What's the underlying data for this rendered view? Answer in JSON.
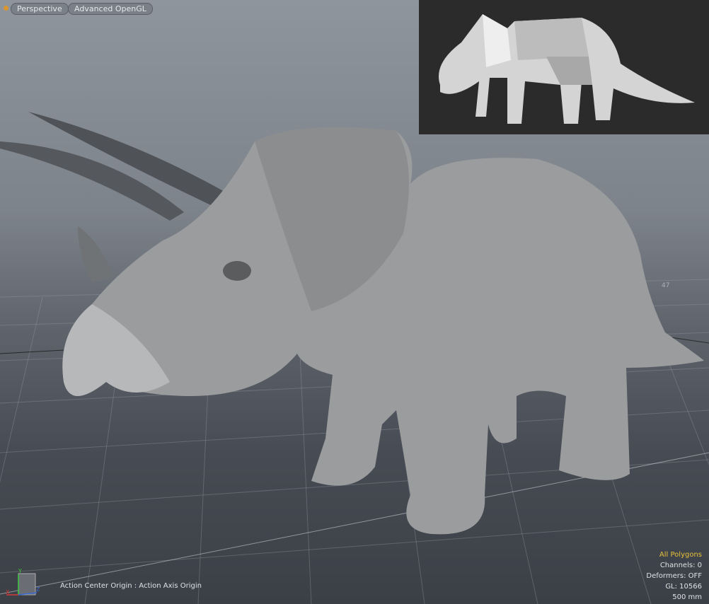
{
  "viewport": {
    "view_type": "Perspective",
    "render_mode": "Advanced OpenGL",
    "grid_label": "47",
    "status_text": "Action Center Origin : Action Axis Origin",
    "hud": {
      "selection": "All Polygons",
      "channels": "Channels: 0",
      "deformers": "Deformers: OFF",
      "gl": "GL: 10566",
      "scale": "500 mm"
    },
    "axis_labels": {
      "x": "X",
      "y": "Y",
      "z": "Z"
    },
    "colors": {
      "selection": "#e8c23a",
      "indicator": "#d9962f",
      "inset_bg": "#2b2b2b"
    }
  }
}
